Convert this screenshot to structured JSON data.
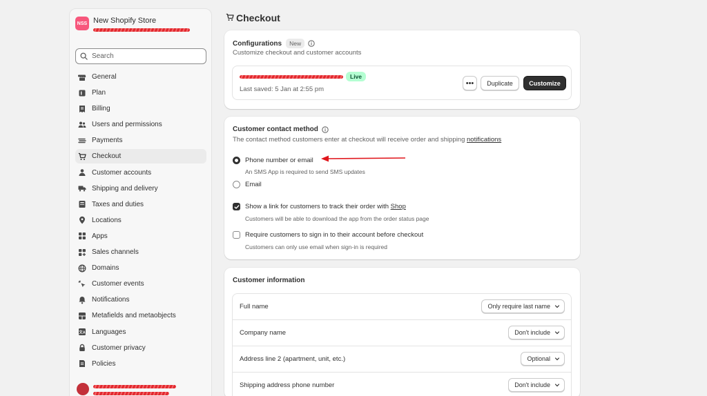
{
  "store": {
    "badge": "NSS",
    "name": "New Shopify Store"
  },
  "search": {
    "placeholder": "Search"
  },
  "nav": [
    {
      "label": "General",
      "icon": "store-icon"
    },
    {
      "label": "Plan",
      "icon": "plan-icon"
    },
    {
      "label": "Billing",
      "icon": "billing-icon"
    },
    {
      "label": "Users and permissions",
      "icon": "users-icon"
    },
    {
      "label": "Payments",
      "icon": "payments-icon"
    },
    {
      "label": "Checkout",
      "icon": "cart-icon",
      "active": true
    },
    {
      "label": "Customer accounts",
      "icon": "person-icon"
    },
    {
      "label": "Shipping and delivery",
      "icon": "truck-icon"
    },
    {
      "label": "Taxes and duties",
      "icon": "taxes-icon"
    },
    {
      "label": "Locations",
      "icon": "location-icon"
    },
    {
      "label": "Apps",
      "icon": "apps-icon"
    },
    {
      "label": "Sales channels",
      "icon": "channels-icon"
    },
    {
      "label": "Domains",
      "icon": "globe-icon"
    },
    {
      "label": "Customer events",
      "icon": "cursor-icon"
    },
    {
      "label": "Notifications",
      "icon": "bell-icon"
    },
    {
      "label": "Metafields and metaobjects",
      "icon": "metafields-icon"
    },
    {
      "label": "Languages",
      "icon": "language-icon"
    },
    {
      "label": "Customer privacy",
      "icon": "lock-icon"
    },
    {
      "label": "Policies",
      "icon": "policies-icon"
    }
  ],
  "page": {
    "title": "Checkout"
  },
  "configurations": {
    "title": "Configurations",
    "badge": "New",
    "subtitle": "Customize checkout and customer accounts",
    "last_saved": "Last saved: 5 Jan at 2:55 pm",
    "status": "Live",
    "more_label": "•••",
    "duplicate_label": "Duplicate",
    "customize_label": "Customize"
  },
  "contact": {
    "title": "Customer contact method",
    "desc_prefix": "The contact method customers enter at checkout will receive order and shipping ",
    "desc_link": "notifications",
    "option1": "Phone number or email",
    "option1_help": "An SMS App is required to send SMS updates",
    "option2": "Email",
    "check1_prefix": "Show a link for customers to track their order with ",
    "check1_link": "Shop",
    "check1_help": "Customers will be able to download the app from the order status page",
    "check2": "Require customers to sign in to their account before checkout",
    "check2_help": "Customers can only use email when sign-in is required"
  },
  "customer_info": {
    "title": "Customer information",
    "rows": [
      {
        "label": "Full name",
        "value": "Only require last name"
      },
      {
        "label": "Company name",
        "value": "Don't include"
      },
      {
        "label": "Address line 2 (apartment, unit, etc.)",
        "value": "Optional"
      },
      {
        "label": "Shipping address phone number",
        "value": "Don't include"
      }
    ]
  },
  "colors": {
    "badge": "#f7577c",
    "live_bg": "#b4fed2",
    "annotation_arrow": "#e0161c"
  }
}
